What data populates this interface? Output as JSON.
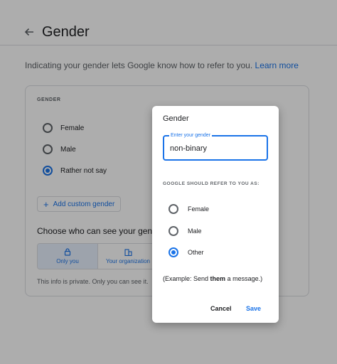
{
  "header": {
    "title": "Gender"
  },
  "intro": {
    "text": "Indicating your gender lets Google know how to refer to you.",
    "link": "Learn more"
  },
  "gender_section": {
    "label": "GENDER",
    "options": [
      {
        "label": "Female",
        "selected": false
      },
      {
        "label": "Male",
        "selected": false
      },
      {
        "label": "Rather not say",
        "selected": true
      }
    ],
    "add_button": "Add custom gender"
  },
  "visibility": {
    "title": "Choose who can see your gender",
    "tabs": [
      {
        "label": "Only you",
        "icon": "lock-icon",
        "selected": true
      },
      {
        "label": "Your organization",
        "icon": "building-icon",
        "selected": false
      }
    ],
    "note": "This info is private. Only you can see it."
  },
  "dialog": {
    "title": "Gender",
    "field": {
      "label": "Enter your gender",
      "value": "non-binary"
    },
    "refer_label": "GOOGLE SHOULD REFER TO YOU AS:",
    "options": [
      {
        "label": "Female",
        "selected": false
      },
      {
        "label": "Male",
        "selected": false
      },
      {
        "label": "Other",
        "selected": true
      }
    ],
    "example_prefix": "(Example: Send ",
    "example_bold": "them",
    "example_suffix": " a message.)",
    "cancel": "Cancel",
    "save": "Save"
  },
  "colors": {
    "accent": "#1a73e8",
    "scrim": "rgba(0,0,0,0.32)"
  }
}
